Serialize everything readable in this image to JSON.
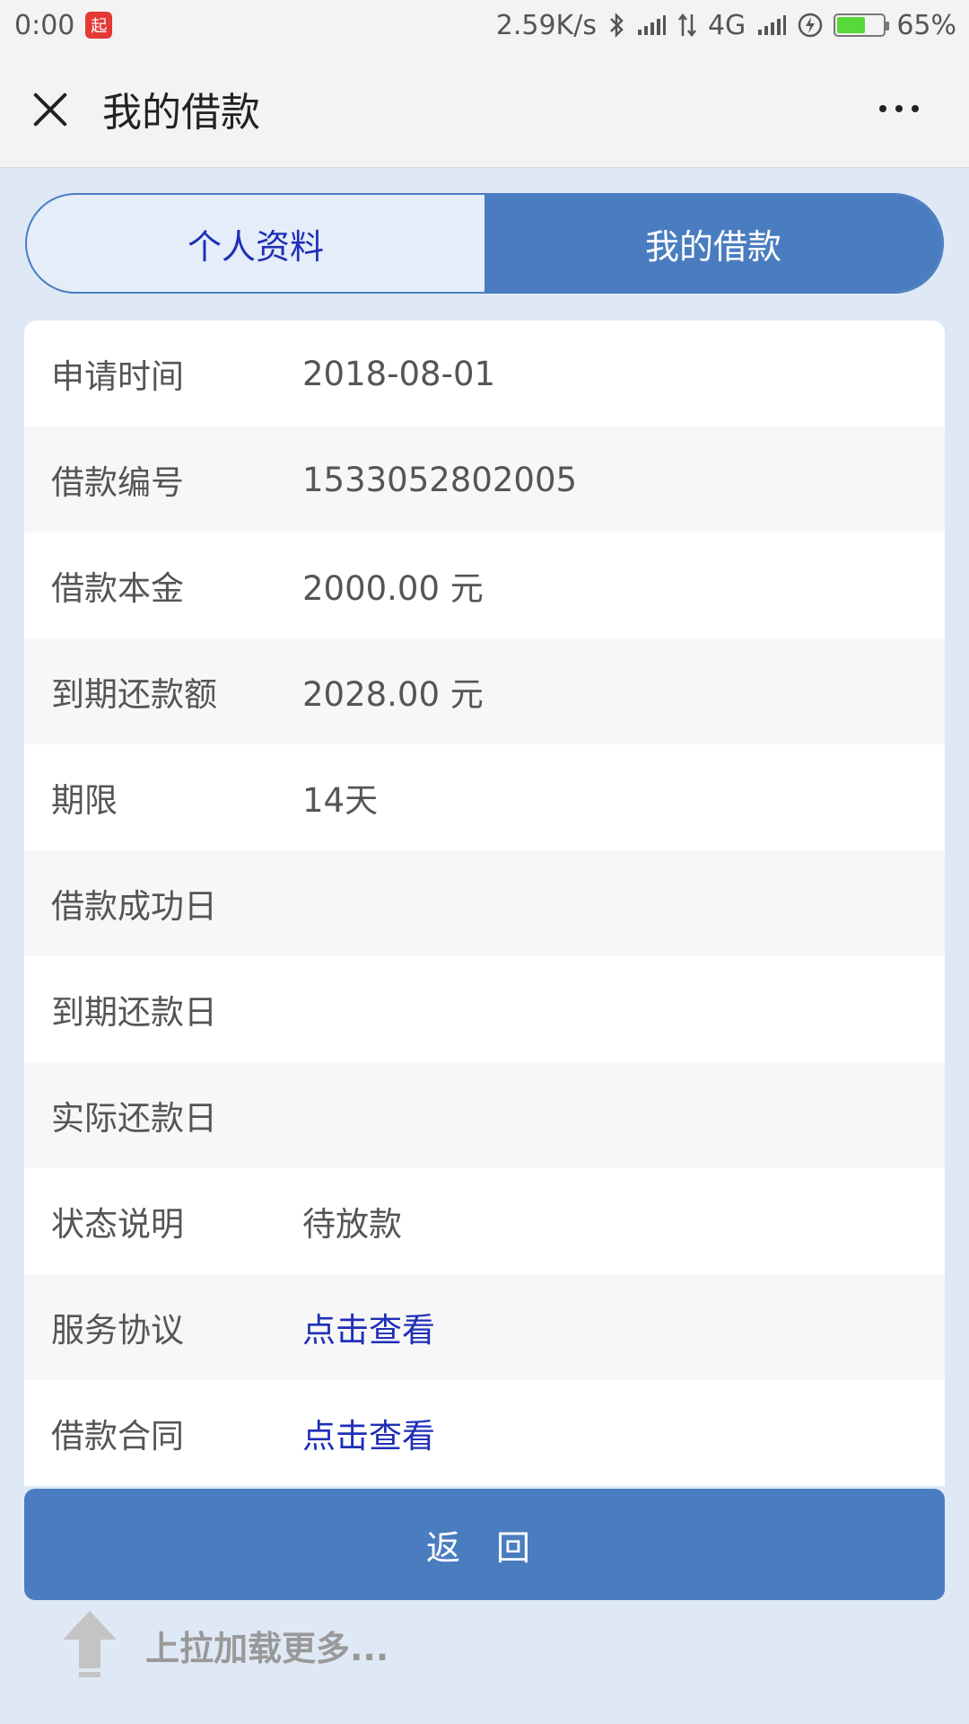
{
  "status_bar": {
    "time": "0:00",
    "app_badge": "起",
    "network_speed": "2.59K/s",
    "network_type": "4G",
    "battery_percent": "65%",
    "battery_level": 0.65
  },
  "header": {
    "title": "我的借款"
  },
  "tabs": [
    {
      "label": "个人资料",
      "active": false
    },
    {
      "label": "我的借款",
      "active": true
    }
  ],
  "loan_details": [
    {
      "label": "申请时间",
      "value": "2018-08-01"
    },
    {
      "label": "借款编号",
      "value": "1533052802005"
    },
    {
      "label": "借款本金",
      "value": "2000.00 元"
    },
    {
      "label": "到期还款额",
      "value": "2028.00 元"
    },
    {
      "label": "期限",
      "value": "14天"
    },
    {
      "label": "借款成功日",
      "value": ""
    },
    {
      "label": "到期还款日",
      "value": ""
    },
    {
      "label": "实际还款日",
      "value": ""
    },
    {
      "label": "状态说明",
      "value": "待放款"
    },
    {
      "label": "服务协议",
      "value": "点击查看"
    },
    {
      "label": "借款合同",
      "value": "点击查看"
    }
  ],
  "footer": {
    "back_label": "返 回",
    "load_more": "上拉加载更多..."
  },
  "colors": {
    "accent": "#4a7dc0",
    "link": "#1f2fb7",
    "background": "#dfe9f5"
  }
}
